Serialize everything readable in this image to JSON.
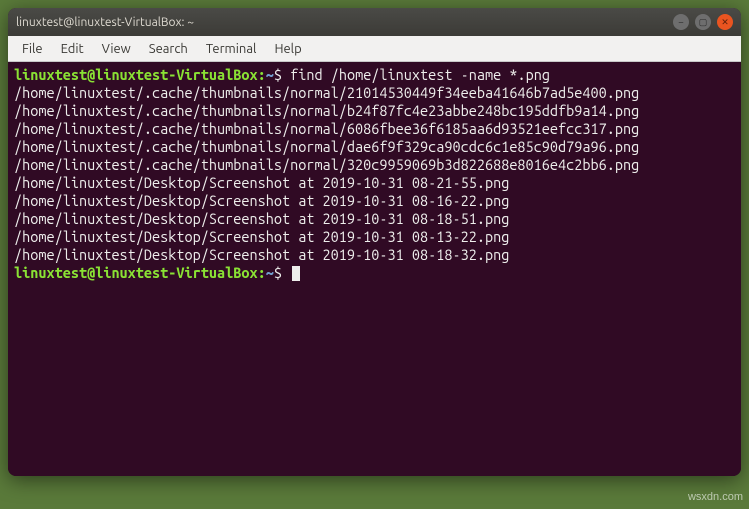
{
  "window": {
    "title": "linuxtest@linuxtest-VirtualBox: ~"
  },
  "menubar": {
    "file": "File",
    "edit": "Edit",
    "view": "View",
    "search": "Search",
    "terminal": "Terminal",
    "help": "Help"
  },
  "prompt": {
    "user_host": "linuxtest@linuxtest-VirtualBox",
    "path": "~",
    "suffix": "$"
  },
  "command": "find /home/linuxtest -name *.png",
  "output": [
    "/home/linuxtest/.cache/thumbnails/normal/21014530449f34eeba41646b7ad5e400.png",
    "/home/linuxtest/.cache/thumbnails/normal/b24f87fc4e23abbe248bc195ddfb9a14.png",
    "/home/linuxtest/.cache/thumbnails/normal/6086fbee36f6185aa6d93521eefcc317.png",
    "/home/linuxtest/.cache/thumbnails/normal/dae6f9f329ca90cdc6c1e85c90d79a96.png",
    "/home/linuxtest/.cache/thumbnails/normal/320c9959069b3d822688e8016e4c2bb6.png",
    "/home/linuxtest/Desktop/Screenshot at 2019-10-31 08-21-55.png",
    "/home/linuxtest/Desktop/Screenshot at 2019-10-31 08-16-22.png",
    "/home/linuxtest/Desktop/Screenshot at 2019-10-31 08-18-51.png",
    "/home/linuxtest/Desktop/Screenshot at 2019-10-31 08-13-22.png",
    "/home/linuxtest/Desktop/Screenshot at 2019-10-31 08-18-32.png"
  ],
  "watermark": "wsxdn.com",
  "icons": {
    "minimize": "–",
    "maximize": "▢",
    "close": "✕"
  }
}
